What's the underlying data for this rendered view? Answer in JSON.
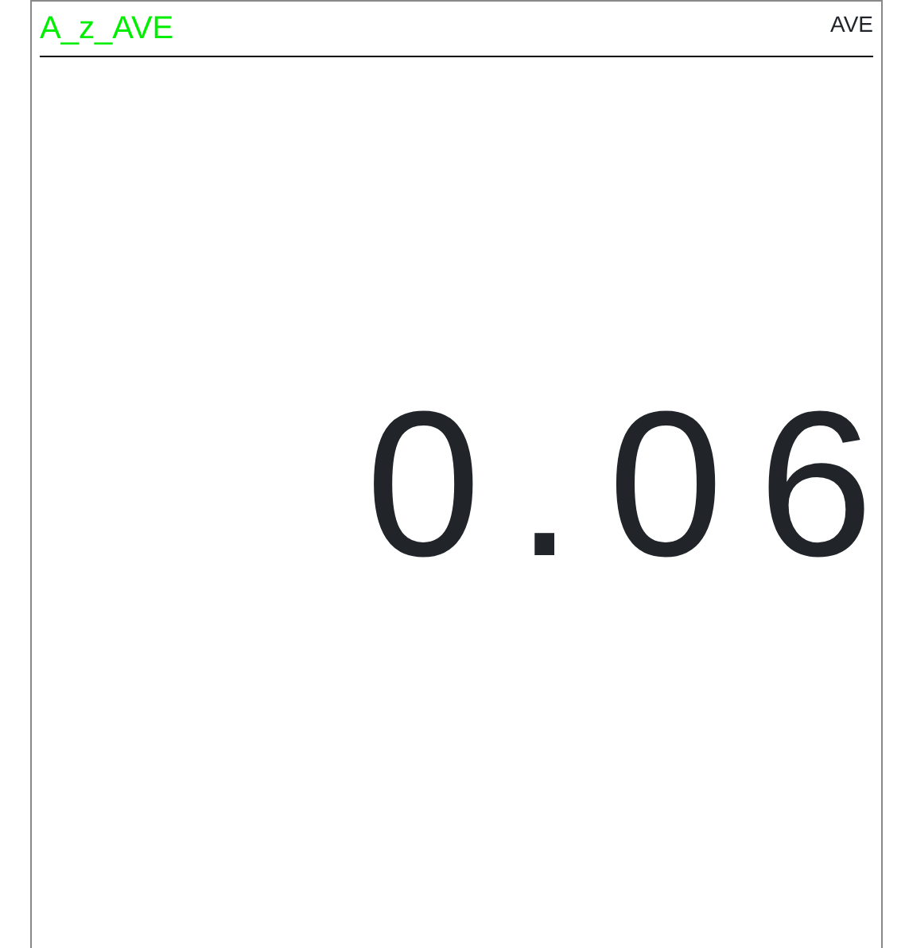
{
  "panel": {
    "title": "A_z_AVE",
    "mode": "AVE",
    "value": "0.06"
  }
}
